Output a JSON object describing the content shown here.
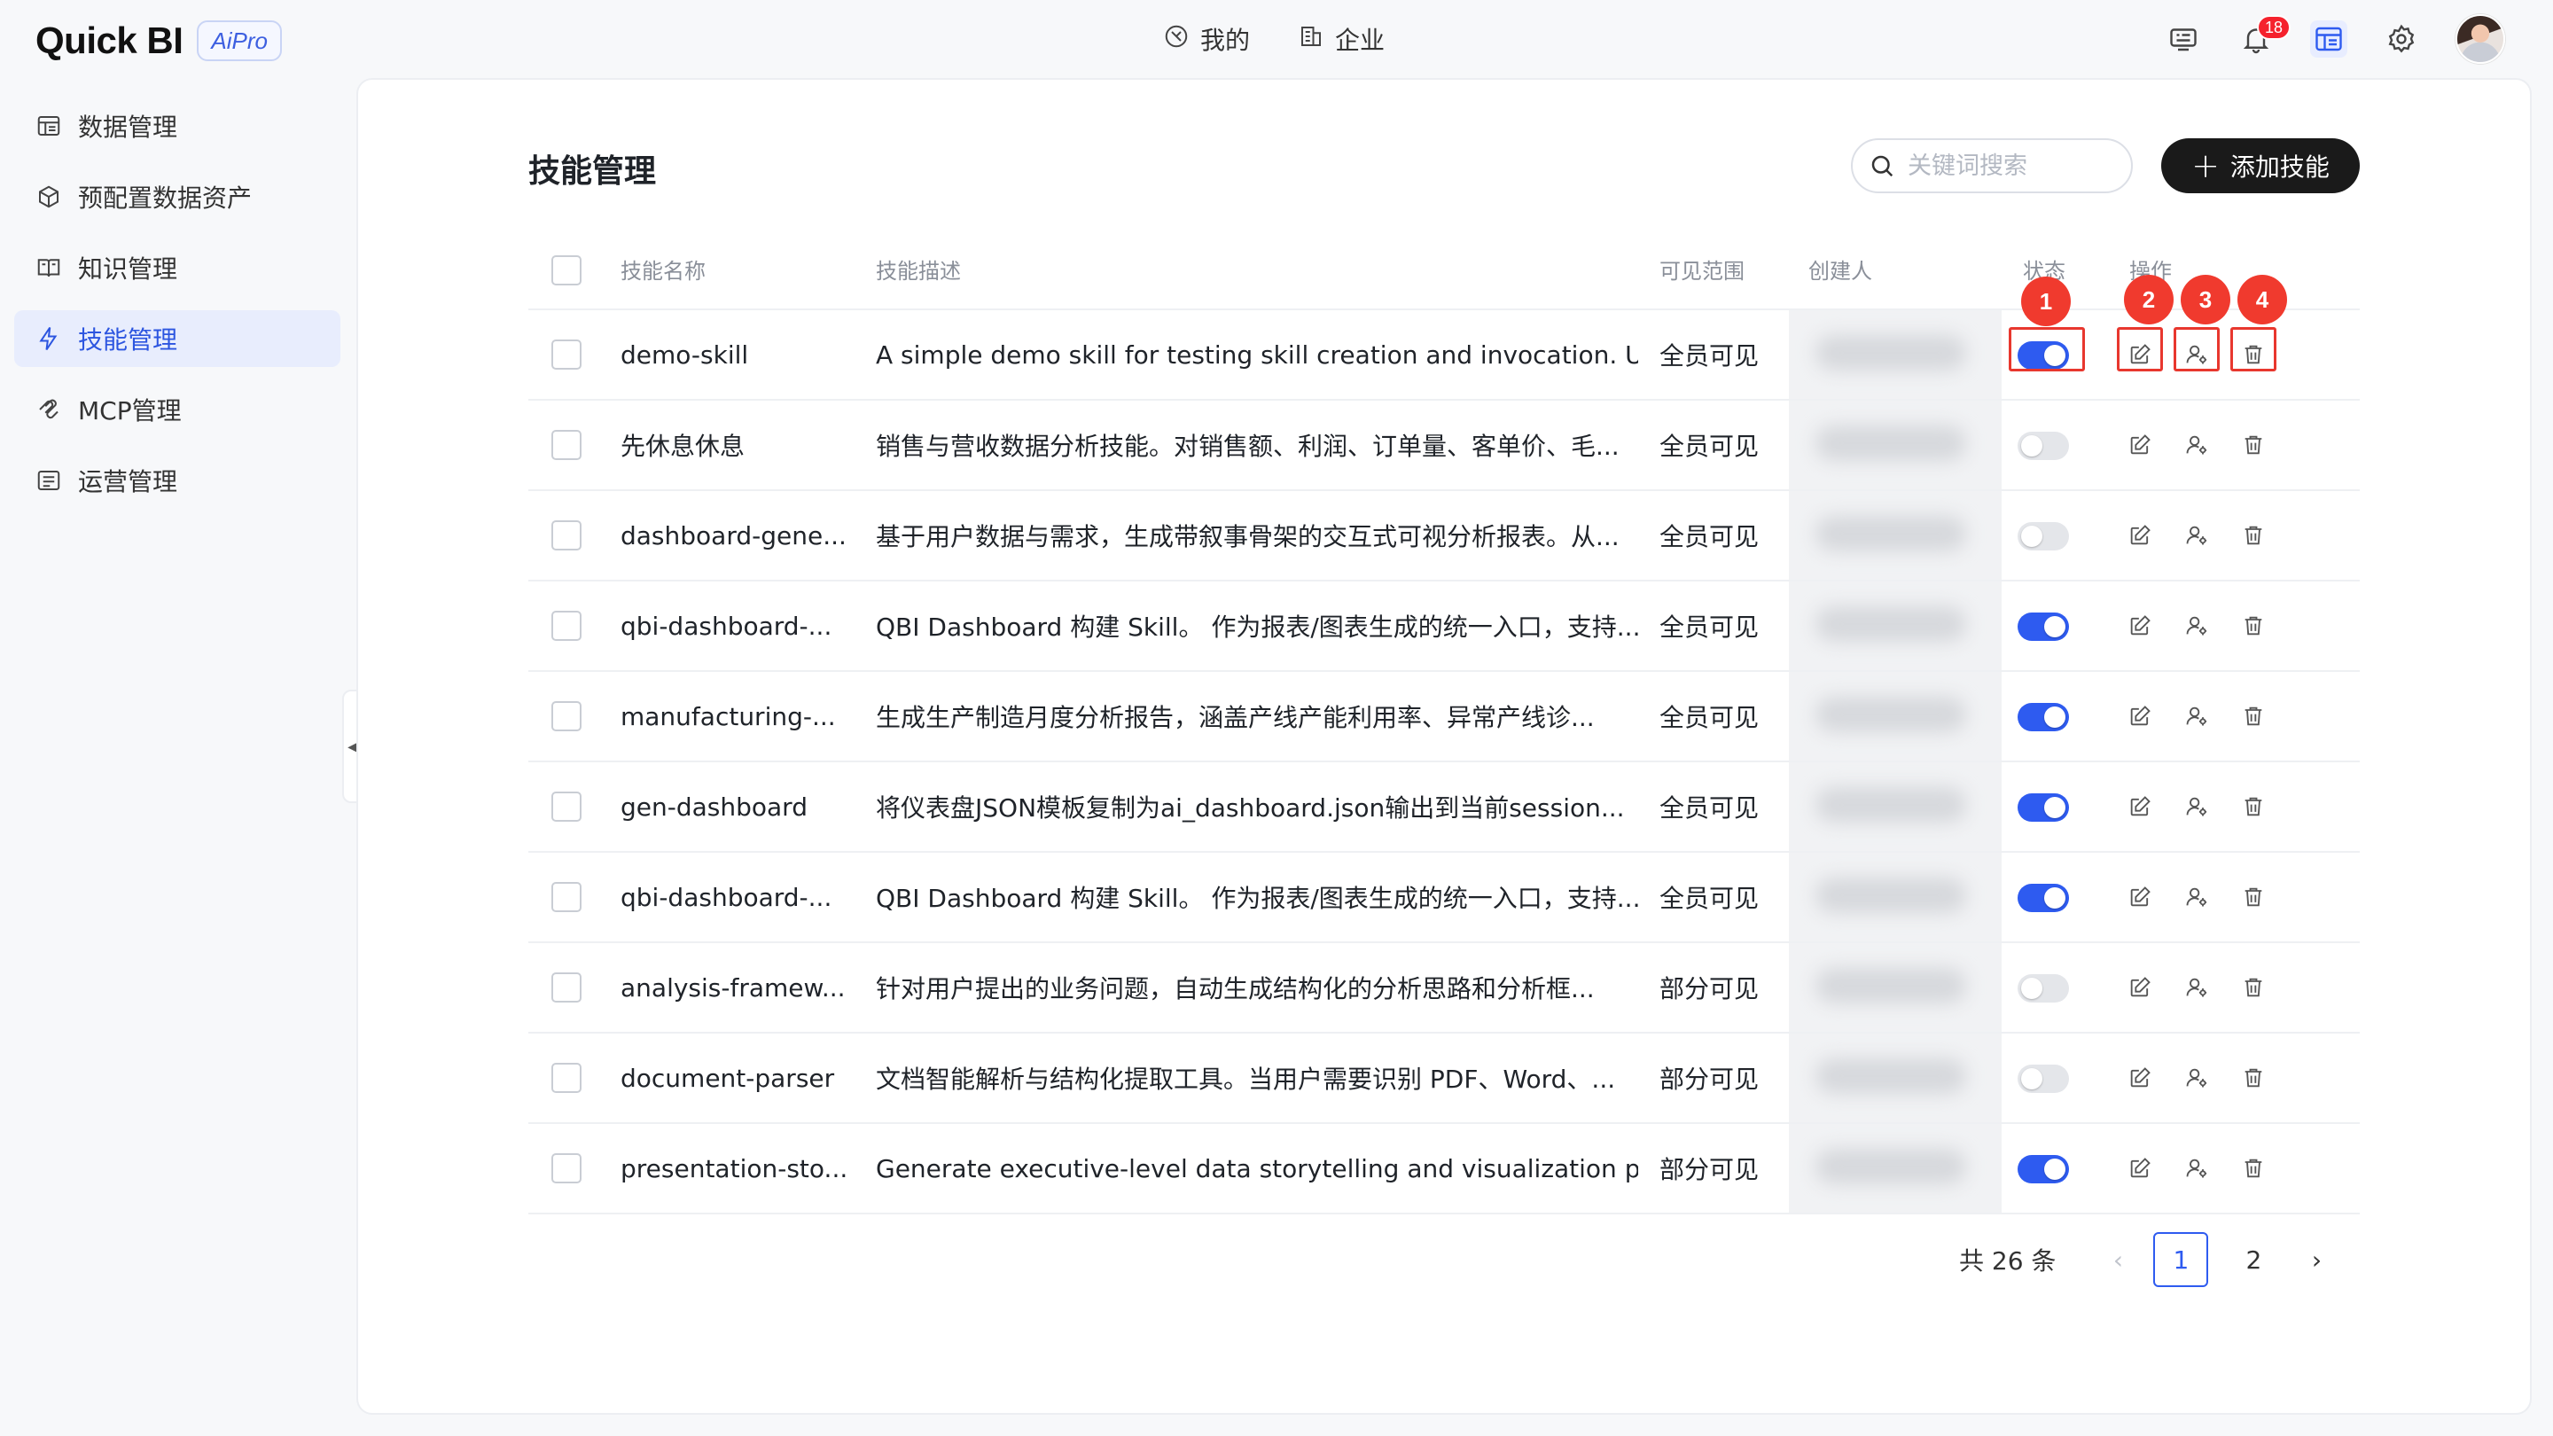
{
  "app": {
    "logo_text": "Quick BI",
    "logo_badge": "AiPro"
  },
  "topnav": [
    {
      "label": "我的",
      "icon": "my-icon"
    },
    {
      "label": "企业",
      "icon": "enterprise-icon"
    }
  ],
  "topbar": {
    "notification_count": "18"
  },
  "sidebar": {
    "items": [
      {
        "label": "数据管理",
        "icon": "data-table-icon",
        "active": false
      },
      {
        "label": "预配置数据资产",
        "icon": "cube-icon",
        "active": false
      },
      {
        "label": "知识管理",
        "icon": "book-icon",
        "active": false
      },
      {
        "label": "技能管理",
        "icon": "lightning-icon",
        "active": true
      },
      {
        "label": "MCP管理",
        "icon": "mcp-icon",
        "active": false
      },
      {
        "label": "运营管理",
        "icon": "operations-icon",
        "active": false
      }
    ]
  },
  "page": {
    "title": "技能管理",
    "search_placeholder": "关键词搜索",
    "add_button": "添加技能"
  },
  "table": {
    "columns": {
      "name": "技能名称",
      "desc": "技能描述",
      "scope": "可见范围",
      "creator": "创建人",
      "status": "状态",
      "actions": "操作"
    },
    "rows": [
      {
        "name": "demo-skill",
        "desc": "A simple demo skill for testing skill creation and invocation. Us...",
        "scope": "全员可见",
        "enabled": true
      },
      {
        "name": "先休息休息",
        "desc": "销售与营收数据分析技能。对销售额、利润、订单量、客单价、毛...",
        "scope": "全员可见",
        "enabled": false
      },
      {
        "name": "dashboard-gene...",
        "desc": "基于用户数据与需求，生成带叙事骨架的交互式可视分析报表。从...",
        "scope": "全员可见",
        "enabled": false
      },
      {
        "name": "qbi-dashboard-...",
        "desc": "QBI Dashboard 构建 Skill。 作为报表/图表生成的统一入口，支持...",
        "scope": "全员可见",
        "enabled": true
      },
      {
        "name": "manufacturing-...",
        "desc": "生成生产制造月度分析报告，涵盖产线产能利用率、异常产线诊...",
        "scope": "全员可见",
        "enabled": true
      },
      {
        "name": "gen-dashboard",
        "desc": "将仪表盘JSON模板复制为ai_dashboard.json输出到当前session...",
        "scope": "全员可见",
        "enabled": true
      },
      {
        "name": "qbi-dashboard-...",
        "desc": "QBI Dashboard 构建 Skill。 作为报表/图表生成的统一入口，支持...",
        "scope": "全员可见",
        "enabled": true
      },
      {
        "name": "analysis-framew...",
        "desc": "针对用户提出的业务问题，自动生成结构化的分析思路和分析框...",
        "scope": "部分可见",
        "enabled": false
      },
      {
        "name": "document-parser",
        "desc": "文档智能解析与结构化提取工具。当用户需要识别 PDF、Word、...",
        "scope": "部分可见",
        "enabled": false
      },
      {
        "name": "presentation-sto...",
        "desc": "Generate executive-level data storytelling and visualization pa...",
        "scope": "部分可见",
        "enabled": true
      }
    ]
  },
  "annotations": [
    "1",
    "2",
    "3",
    "4"
  ],
  "pagination": {
    "total": "共 26 条",
    "pages": [
      "1",
      "2"
    ],
    "current": "1"
  },
  "colors": {
    "accent": "#2e5bf0",
    "annotation_red": "#f03a2e",
    "sidebar_active_bg": "#e8edfd",
    "primary_button": "#1a1a1a"
  }
}
